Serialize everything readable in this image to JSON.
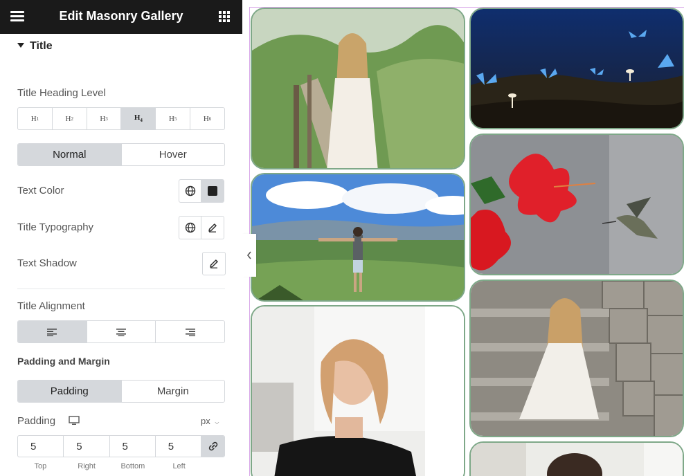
{
  "header": {
    "title": "Edit Masonry Gallery",
    "menu_icon": "hamburger-icon",
    "apps_icon": "grid-icon"
  },
  "section": {
    "title": "Title"
  },
  "heading_level": {
    "label": "Title Heading Level",
    "options": [
      "H1",
      "H2",
      "H3",
      "H4",
      "H5",
      "H6"
    ],
    "active": "H4"
  },
  "state_tabs": {
    "normal": "Normal",
    "hover": "Hover",
    "active": "Normal"
  },
  "text_color": {
    "label": "Text Color",
    "swatch": "#222222"
  },
  "typography": {
    "label": "Title Typography"
  },
  "text_shadow": {
    "label": "Text Shadow"
  },
  "alignment": {
    "label": "Title Alignment",
    "active": "left"
  },
  "padding_margin": {
    "label": "Padding and Margin",
    "tabs": {
      "padding": "Padding",
      "margin": "Margin",
      "active": "Padding"
    }
  },
  "padding": {
    "label": "Padding",
    "unit": "px",
    "values": {
      "top": "5",
      "right": "5",
      "bottom": "5",
      "left": "5"
    },
    "captions": {
      "top": "Top",
      "right": "Right",
      "bottom": "Bottom",
      "left": "Left"
    }
  },
  "colors": {
    "topbar": "#1a1a1a",
    "active_segment": "#d5d8dc",
    "tile_border": "#7ea888",
    "preview_outline": "#d9a8e8"
  },
  "gallery": {
    "images": [
      "woman-white-dress-garden-path",
      "blue-butterflies-mushrooms",
      "man-arms-outstretched-mountains",
      "red-hibiscus-hummingbird",
      "blonde-woman-black-top-portrait",
      "woman-white-dress-stone-steps",
      "woman-portrait-partial"
    ]
  }
}
